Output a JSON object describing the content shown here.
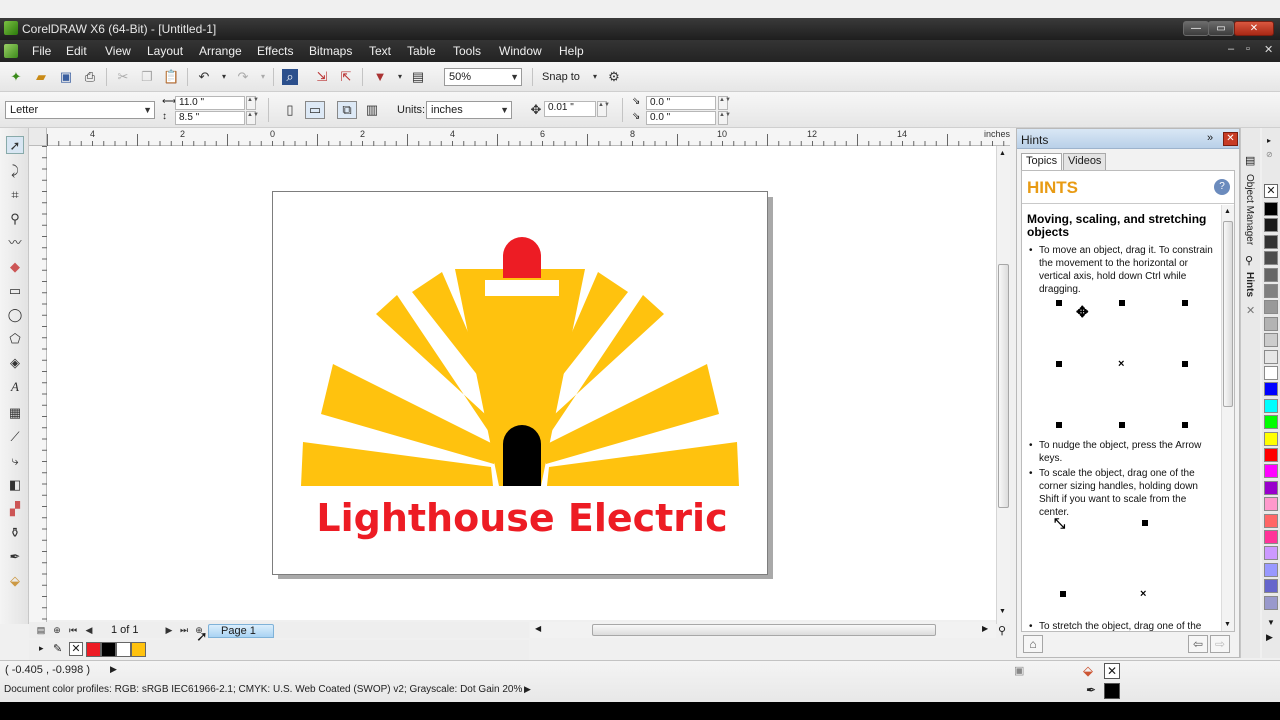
{
  "window": {
    "title": "CorelDRAW X6 (64-Bit) - [Untitled-1]",
    "controls": {
      "minimize": "—",
      "maximize": "▭",
      "close": "✕"
    }
  },
  "menu": {
    "items": [
      "File",
      "Edit",
      "View",
      "Layout",
      "Arrange",
      "Effects",
      "Bitmaps",
      "Text",
      "Table",
      "Tools",
      "Window",
      "Help"
    ]
  },
  "standard_toolbar": {
    "zoom": "50%",
    "snap_to": "Snap to"
  },
  "property_bar": {
    "page_size": "Letter",
    "width": "11.0 \"",
    "height": "8.5 \"",
    "units_label": "Units:",
    "units_value": "inches",
    "nudge": "0.01 \"",
    "dup_x": "0.0 \"",
    "dup_y": "0.0 \""
  },
  "ruler": {
    "units": "inches",
    "top_labels": [
      "4",
      "2",
      "0",
      "2",
      "4",
      "6",
      "8",
      "10",
      "12",
      "14"
    ]
  },
  "artwork": {
    "logo_text": "Lighthouse Electric",
    "colors": {
      "yellow": "#FFC20E",
      "red": "#ED1C24",
      "black": "#000000"
    }
  },
  "page_nav": {
    "counter": "1 of 1",
    "page_tab": "Page 1"
  },
  "status": {
    "coords": "( -0.405 , -0.998 )",
    "color_profiles": "Document color profiles: RGB: sRGB IEC61966-2.1; CMYK: U.S. Web Coated (SWOP) v2; Grayscale: Dot Gain 20%"
  },
  "docker": {
    "title": "Hints",
    "tabs": [
      "Topics",
      "Videos"
    ],
    "header": "HINTS",
    "topic_title": "Moving, scaling, and stretching objects",
    "bullets": [
      "To move an object, drag it. To constrain the movement to the horizontal or vertical axis, hold down Ctrl while dragging.",
      "To nudge the object, press the Arrow keys.",
      "To scale the object, drag one of the corner sizing handles, holding down Shift if you want to scale from the center.",
      "To stretch the object, drag one of the"
    ],
    "side_tabs": [
      "Object Manager",
      "Hints"
    ]
  },
  "document_palette": [
    "#ED1C24",
    "#000000",
    "#FFFFFF",
    "#FFC20E"
  ],
  "color_palette": [
    "#000000",
    "#1a1a1a",
    "#333333",
    "#4d4d4d",
    "#666666",
    "#808080",
    "#999999",
    "#b3b3b3",
    "#cccccc",
    "#e6e6e6",
    "#ffffff",
    "#0000ff",
    "#00ffff",
    "#00ff00",
    "#ffff00",
    "#ff0000",
    "#ff00ff",
    "#9900cc",
    "#ff99cc",
    "#ff6666",
    "#ff3399",
    "#cc99ff",
    "#9999ff",
    "#6666cc",
    "#9999cc"
  ]
}
